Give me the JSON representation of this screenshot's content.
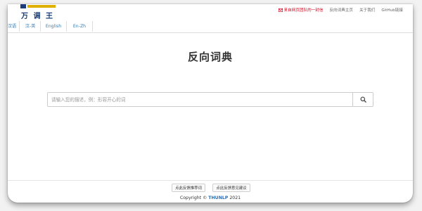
{
  "header": {
    "logo_text": "万 调 王",
    "nav": {
      "mail_label": "来自网页团队的一封信",
      "home_label": "反向词典主页",
      "about_label": "关于我们",
      "github_label": "GitHub链接"
    }
  },
  "tabs": [
    {
      "label": "汉语"
    },
    {
      "label": "汉-英"
    },
    {
      "label": "English"
    },
    {
      "label": "En-Zh"
    }
  ],
  "main": {
    "title": "反向词典",
    "search_placeholder": "请输入您的描述，例：形容开心的词"
  },
  "footer": {
    "recommend_button": "点此反馈推荐词",
    "feedback_button": "点此反馈意见建议",
    "copyright_prefix": "Copyright ©",
    "copyright_brand": "THUNLP",
    "copyright_year": "2021"
  },
  "colors": {
    "link": "#337ab7",
    "mail_red": "#d0021b",
    "logo_blue": "#1a3c7a"
  },
  "icons": {
    "search": "search-icon",
    "mail": "mail-icon"
  }
}
